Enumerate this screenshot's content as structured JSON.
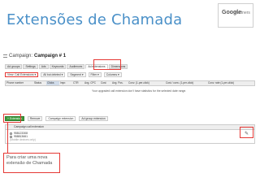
{
  "slide": {
    "title": "Extensões de Chamada",
    "logo_google": "Google",
    "logo_partners": "Partners"
  },
  "app": {
    "campaign_label": "Campaign:",
    "campaign_name": "Campaign # 1",
    "tabs": [
      "Ad groups",
      "Settings",
      "Ads",
      "Keywords",
      "Audiences",
      "Ad extensions",
      "Dimensions"
    ],
    "active_tab_index": 5,
    "toolbar": {
      "view": "View: Call Extensions ▾",
      "all_but_deleted": "All but deleted ▾",
      "segment": "Segment ▾",
      "filter": "Filter ▾",
      "columns": "Columns ▾"
    },
    "grid_columns": [
      "Phone number",
      "Status",
      "Clicks",
      "Impr.",
      "CTR",
      "Avg. CPC",
      "Cost",
      "Avg. Pos.",
      "Conv. (1-per-click)",
      "Cost / conv. (1-per-click)",
      "Conv. rate (1-per-click)"
    ],
    "notice": "Your upgraded call extension don't have statistics for the selected date range.",
    "subbar": {
      "extension_button": "+ Extension",
      "remove": "Remove",
      "campaign_ext": "Campaign extension",
      "adgroup_ext": "Ad group extension"
    },
    "ext_table": {
      "header": "Campaign call extension",
      "phone1": "958123308",
      "phone2": "958813661",
      "note": "(Mobile devices only)"
    }
  },
  "callout": {
    "text": "Para criar uma nova extensão de Chamada"
  },
  "colors": {
    "title_blue": "#4a90c8",
    "highlight_red": "#e53935",
    "button_green": "#3c9b3c"
  }
}
